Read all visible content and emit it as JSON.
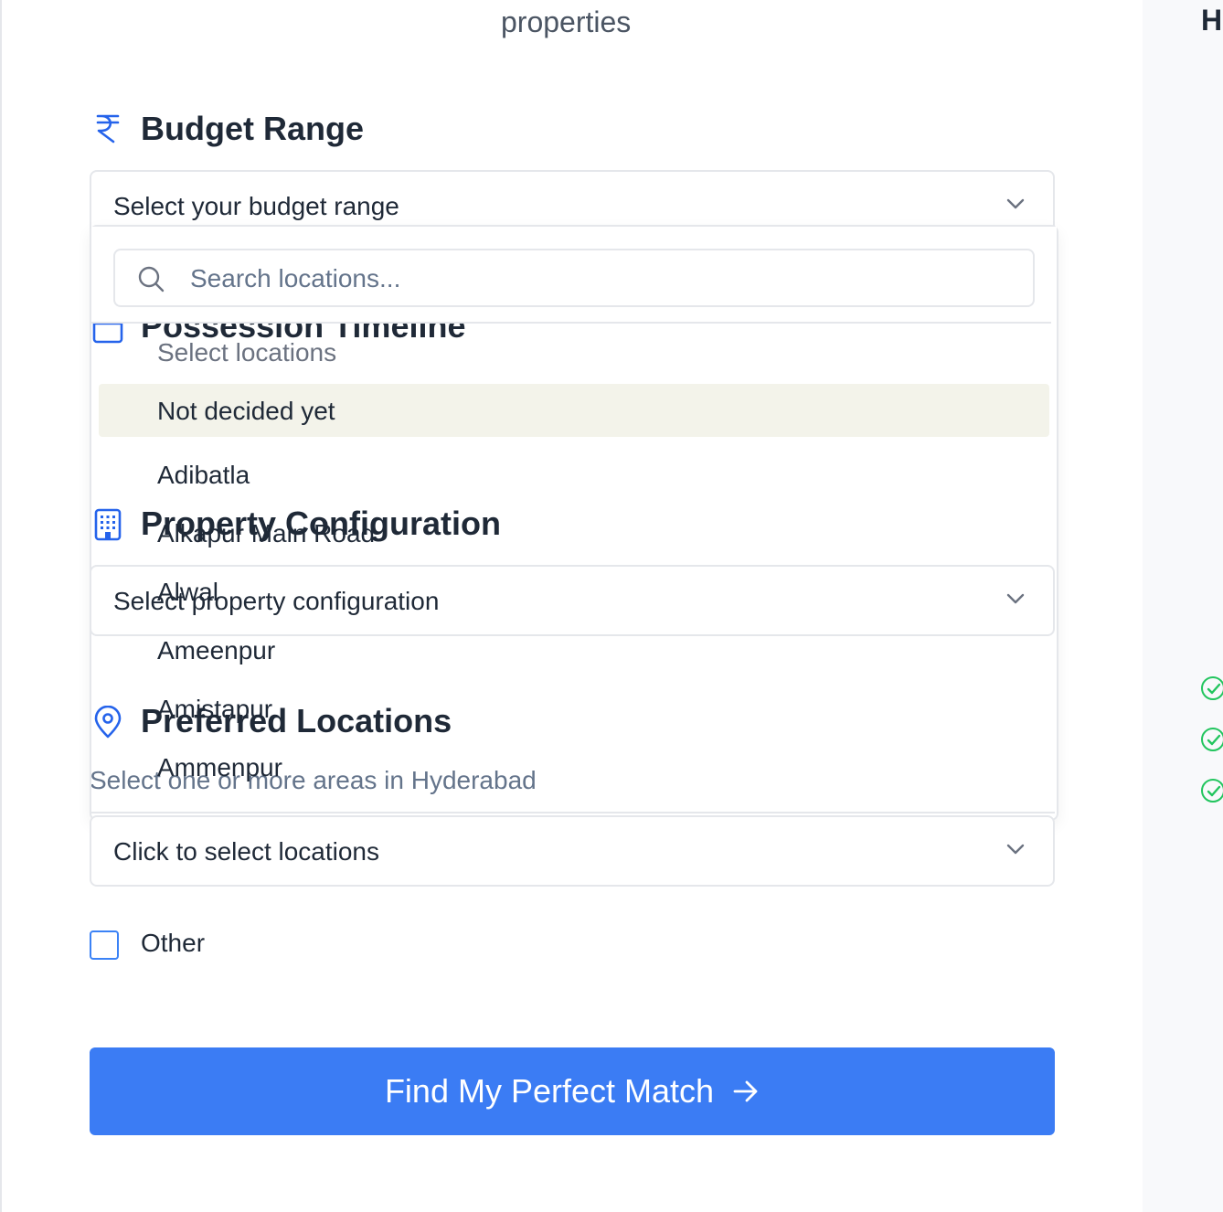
{
  "header": {
    "top_text": "properties",
    "right_letter": "H"
  },
  "budget": {
    "title": "Budget Range",
    "icon": "rupee-icon",
    "placeholder": "Select your budget range"
  },
  "possession": {
    "title": "Possession Timeline",
    "icon": "calendar-icon"
  },
  "configuration": {
    "title": "Property Configuration",
    "icon": "building-icon",
    "placeholder": "Select property configuration"
  },
  "locations": {
    "title": "Preferred Locations",
    "icon": "map-pin-icon",
    "subtitle": "Select one or more areas in Hyderabad",
    "placeholder": "Click to select locations"
  },
  "dropdown": {
    "search_placeholder": "Search locations...",
    "group_label": "Select locations",
    "items": [
      "Not decided yet",
      "Adibatla",
      "Alkapur Main Road",
      "Alwal",
      "Ameenpur",
      "Amistapur",
      "Ammenpur"
    ]
  },
  "other": {
    "label": "Other",
    "checked": false
  },
  "cta": {
    "label": "Find My Perfect Match",
    "icon": "arrow-right-icon"
  },
  "colors": {
    "accent": "#3b7cf4",
    "icon_blue": "#2563eb",
    "success": "#22c55e",
    "highlight": "#f3f3ea"
  }
}
